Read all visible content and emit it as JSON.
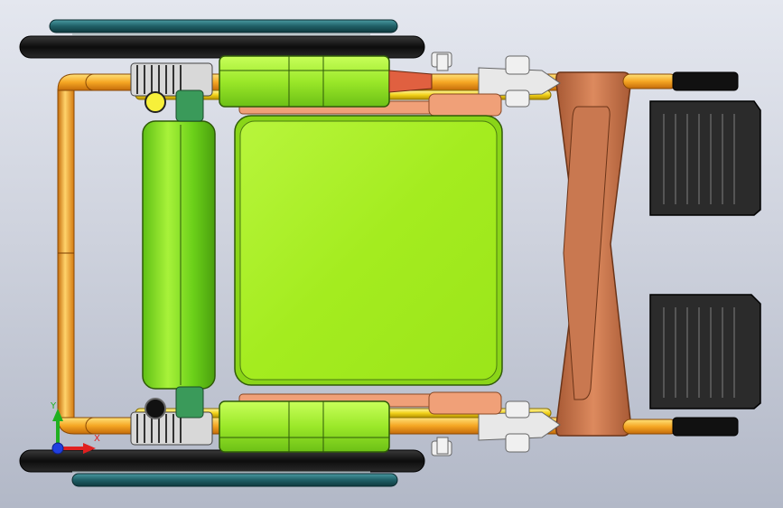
{
  "viewport": {
    "background_top": "#e4e7ef",
    "background_bottom": "#b2b8c7"
  },
  "model": {
    "view": "top",
    "colors": {
      "frame_tube": "#f5a623",
      "frame_tube_yellow": "#f2d21a",
      "cushion": "#a8f02a",
      "backrest_roll": "#7fe01f",
      "tire": "#1a1a1a",
      "handrim": "#1f5f66",
      "footrest_plate": "#2a2a2a",
      "leg_frame": "#cc7a4e",
      "side_guard": "#9be829"
    }
  },
  "triad": {
    "x_label": "X",
    "y_label": "Y",
    "x_color": "#e02020",
    "y_color": "#20b020",
    "z_color": "#2040e0"
  }
}
